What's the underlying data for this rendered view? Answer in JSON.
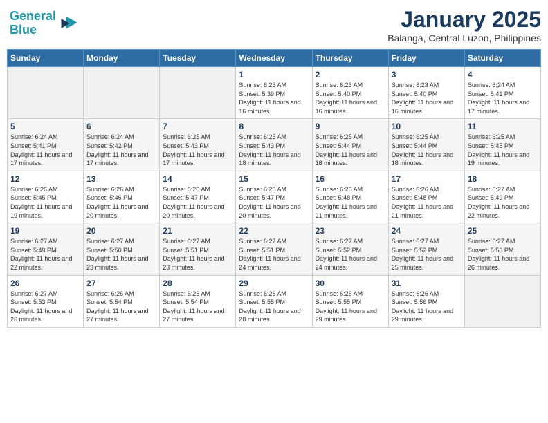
{
  "logo": {
    "line1": "General",
    "line2": "Blue"
  },
  "header": {
    "title": "January 2025",
    "subtitle": "Balanga, Central Luzon, Philippines"
  },
  "weekdays": [
    "Sunday",
    "Monday",
    "Tuesday",
    "Wednesday",
    "Thursday",
    "Friday",
    "Saturday"
  ],
  "weeks": [
    [
      {
        "day": "",
        "sunrise": "",
        "sunset": "",
        "daylight": ""
      },
      {
        "day": "",
        "sunrise": "",
        "sunset": "",
        "daylight": ""
      },
      {
        "day": "",
        "sunrise": "",
        "sunset": "",
        "daylight": ""
      },
      {
        "day": "1",
        "sunrise": "Sunrise: 6:23 AM",
        "sunset": "Sunset: 5:39 PM",
        "daylight": "Daylight: 11 hours and 16 minutes."
      },
      {
        "day": "2",
        "sunrise": "Sunrise: 6:23 AM",
        "sunset": "Sunset: 5:40 PM",
        "daylight": "Daylight: 11 hours and 16 minutes."
      },
      {
        "day": "3",
        "sunrise": "Sunrise: 6:23 AM",
        "sunset": "Sunset: 5:40 PM",
        "daylight": "Daylight: 11 hours and 16 minutes."
      },
      {
        "day": "4",
        "sunrise": "Sunrise: 6:24 AM",
        "sunset": "Sunset: 5:41 PM",
        "daylight": "Daylight: 11 hours and 17 minutes."
      }
    ],
    [
      {
        "day": "5",
        "sunrise": "Sunrise: 6:24 AM",
        "sunset": "Sunset: 5:41 PM",
        "daylight": "Daylight: 11 hours and 17 minutes."
      },
      {
        "day": "6",
        "sunrise": "Sunrise: 6:24 AM",
        "sunset": "Sunset: 5:42 PM",
        "daylight": "Daylight: 11 hours and 17 minutes."
      },
      {
        "day": "7",
        "sunrise": "Sunrise: 6:25 AM",
        "sunset": "Sunset: 5:43 PM",
        "daylight": "Daylight: 11 hours and 17 minutes."
      },
      {
        "day": "8",
        "sunrise": "Sunrise: 6:25 AM",
        "sunset": "Sunset: 5:43 PM",
        "daylight": "Daylight: 11 hours and 18 minutes."
      },
      {
        "day": "9",
        "sunrise": "Sunrise: 6:25 AM",
        "sunset": "Sunset: 5:44 PM",
        "daylight": "Daylight: 11 hours and 18 minutes."
      },
      {
        "day": "10",
        "sunrise": "Sunrise: 6:25 AM",
        "sunset": "Sunset: 5:44 PM",
        "daylight": "Daylight: 11 hours and 18 minutes."
      },
      {
        "day": "11",
        "sunrise": "Sunrise: 6:25 AM",
        "sunset": "Sunset: 5:45 PM",
        "daylight": "Daylight: 11 hours and 19 minutes."
      }
    ],
    [
      {
        "day": "12",
        "sunrise": "Sunrise: 6:26 AM",
        "sunset": "Sunset: 5:45 PM",
        "daylight": "Daylight: 11 hours and 19 minutes."
      },
      {
        "day": "13",
        "sunrise": "Sunrise: 6:26 AM",
        "sunset": "Sunset: 5:46 PM",
        "daylight": "Daylight: 11 hours and 20 minutes."
      },
      {
        "day": "14",
        "sunrise": "Sunrise: 6:26 AM",
        "sunset": "Sunset: 5:47 PM",
        "daylight": "Daylight: 11 hours and 20 minutes."
      },
      {
        "day": "15",
        "sunrise": "Sunrise: 6:26 AM",
        "sunset": "Sunset: 5:47 PM",
        "daylight": "Daylight: 11 hours and 20 minutes."
      },
      {
        "day": "16",
        "sunrise": "Sunrise: 6:26 AM",
        "sunset": "Sunset: 5:48 PM",
        "daylight": "Daylight: 11 hours and 21 minutes."
      },
      {
        "day": "17",
        "sunrise": "Sunrise: 6:26 AM",
        "sunset": "Sunset: 5:48 PM",
        "daylight": "Daylight: 11 hours and 21 minutes."
      },
      {
        "day": "18",
        "sunrise": "Sunrise: 6:27 AM",
        "sunset": "Sunset: 5:49 PM",
        "daylight": "Daylight: 11 hours and 22 minutes."
      }
    ],
    [
      {
        "day": "19",
        "sunrise": "Sunrise: 6:27 AM",
        "sunset": "Sunset: 5:49 PM",
        "daylight": "Daylight: 11 hours and 22 minutes."
      },
      {
        "day": "20",
        "sunrise": "Sunrise: 6:27 AM",
        "sunset": "Sunset: 5:50 PM",
        "daylight": "Daylight: 11 hours and 23 minutes."
      },
      {
        "day": "21",
        "sunrise": "Sunrise: 6:27 AM",
        "sunset": "Sunset: 5:51 PM",
        "daylight": "Daylight: 11 hours and 23 minutes."
      },
      {
        "day": "22",
        "sunrise": "Sunrise: 6:27 AM",
        "sunset": "Sunset: 5:51 PM",
        "daylight": "Daylight: 11 hours and 24 minutes."
      },
      {
        "day": "23",
        "sunrise": "Sunrise: 6:27 AM",
        "sunset": "Sunset: 5:52 PM",
        "daylight": "Daylight: 11 hours and 24 minutes."
      },
      {
        "day": "24",
        "sunrise": "Sunrise: 6:27 AM",
        "sunset": "Sunset: 5:52 PM",
        "daylight": "Daylight: 11 hours and 25 minutes."
      },
      {
        "day": "25",
        "sunrise": "Sunrise: 6:27 AM",
        "sunset": "Sunset: 5:53 PM",
        "daylight": "Daylight: 11 hours and 26 minutes."
      }
    ],
    [
      {
        "day": "26",
        "sunrise": "Sunrise: 6:27 AM",
        "sunset": "Sunset: 5:53 PM",
        "daylight": "Daylight: 11 hours and 26 minutes."
      },
      {
        "day": "27",
        "sunrise": "Sunrise: 6:26 AM",
        "sunset": "Sunset: 5:54 PM",
        "daylight": "Daylight: 11 hours and 27 minutes."
      },
      {
        "day": "28",
        "sunrise": "Sunrise: 6:26 AM",
        "sunset": "Sunset: 5:54 PM",
        "daylight": "Daylight: 11 hours and 27 minutes."
      },
      {
        "day": "29",
        "sunrise": "Sunrise: 6:26 AM",
        "sunset": "Sunset: 5:55 PM",
        "daylight": "Daylight: 11 hours and 28 minutes."
      },
      {
        "day": "30",
        "sunrise": "Sunrise: 6:26 AM",
        "sunset": "Sunset: 5:55 PM",
        "daylight": "Daylight: 11 hours and 29 minutes."
      },
      {
        "day": "31",
        "sunrise": "Sunrise: 6:26 AM",
        "sunset": "Sunset: 5:56 PM",
        "daylight": "Daylight: 11 hours and 29 minutes."
      },
      {
        "day": "",
        "sunrise": "",
        "sunset": "",
        "daylight": ""
      }
    ]
  ]
}
